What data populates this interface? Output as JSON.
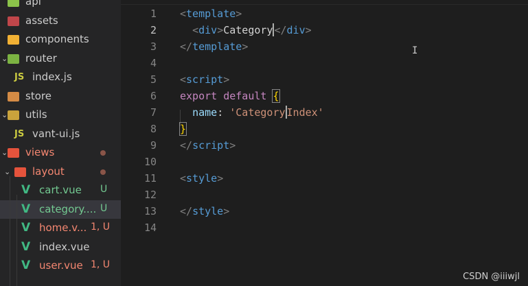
{
  "sidebar": {
    "items": [
      {
        "label": "api",
        "icon": "folder-api-icon",
        "icon_color": "#8bc34a"
      },
      {
        "label": "assets",
        "icon": "folder-assets-icon",
        "icon_color": "#e05252"
      },
      {
        "label": "components",
        "icon": "folder-components-icon",
        "icon_color": "#f2b134"
      },
      {
        "label": "router",
        "icon": "folder-router-icon",
        "icon_color": "#7cb342"
      },
      {
        "label": "index.js",
        "icon": "js-file-icon",
        "icon_glyph": "JS"
      },
      {
        "label": "store",
        "icon": "folder-store-icon",
        "icon_color": "#d48b45"
      },
      {
        "label": "utils",
        "icon": "folder-utils-icon",
        "icon_color": "#c9a33c"
      },
      {
        "label": "vant-ui.js",
        "icon": "js-file-icon",
        "icon_glyph": "JS"
      },
      {
        "label": "views",
        "icon": "folder-vue-icon",
        "icon_color": "#e5533c"
      },
      {
        "label": "layout",
        "icon": "folder-vue-icon",
        "icon_color": "#e5533c"
      },
      {
        "label": "cart.vue",
        "icon": "vue-file-icon",
        "status": "U"
      },
      {
        "label": "category.vue",
        "display": "category....",
        "icon": "vue-file-icon",
        "status": "U"
      },
      {
        "label": "home.v...",
        "icon": "vue-file-icon",
        "status": "1, U"
      },
      {
        "label": "index.vue",
        "icon": "vue-file-icon"
      },
      {
        "label": "user.vue",
        "icon": "vue-file-icon",
        "status": "1, U"
      }
    ],
    "vue_glyph": "V",
    "chevron_right": "›",
    "chevron_down": "⌄"
  },
  "editor": {
    "line_numbers": [
      "1",
      "2",
      "3",
      "4",
      "5",
      "6",
      "7",
      "8",
      "9",
      "10",
      "11",
      "12",
      "13",
      "14"
    ],
    "active_line": "2",
    "code": {
      "l1": {
        "open": "<",
        "tag": "template",
        "close": ">"
      },
      "l2": {
        "indent": "  ",
        "open": "<",
        "tag": "div",
        "close": ">",
        "text": "Category",
        "end_open": "</",
        "end_tag": "div",
        "end_close": ">"
      },
      "l3": {
        "open": "</",
        "tag": "template",
        "close": ">"
      },
      "l5": {
        "open": "<",
        "tag": "script",
        "close": ">"
      },
      "l6": {
        "kw1": "export",
        "kw2": "default",
        "brace": "{"
      },
      "l7": {
        "indent": "  ",
        "prop": "name",
        "colon": ": ",
        "str_a": "'Category",
        "str_b": "Index'"
      },
      "l8": {
        "brace": "}"
      },
      "l9": {
        "open": "</",
        "tag": "script",
        "close": ">"
      },
      "l11": {
        "open": "<",
        "tag": "style",
        "close": ">"
      },
      "l13": {
        "open": "</",
        "tag": "style",
        "close": ">"
      }
    }
  },
  "mouse_cursor_glyph": "I",
  "watermark": "CSDN @iiiwjl",
  "colors": {
    "tag": "#569cd6",
    "keyword": "#c586c0",
    "property": "#9cdcfe",
    "string": "#ce9178",
    "brace": "#ffd700",
    "untracked": "#73c991",
    "error": "#f48771"
  }
}
